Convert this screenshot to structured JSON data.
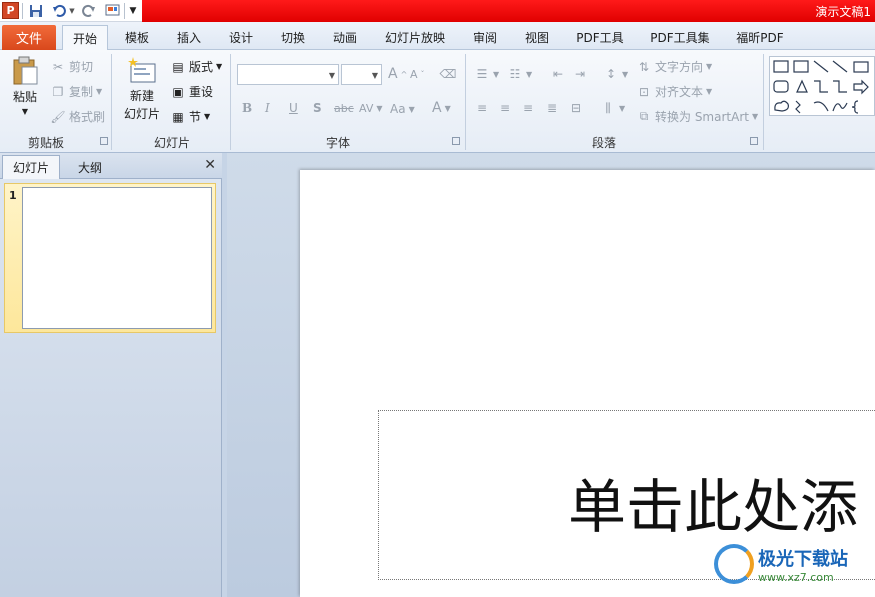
{
  "window": {
    "title": "演示文稿1"
  },
  "app": {
    "icon_letter": "P"
  },
  "tabs": {
    "file": "文件",
    "items": [
      "开始",
      "模板",
      "插入",
      "设计",
      "切换",
      "动画",
      "幻灯片放映",
      "审阅",
      "视图",
      "PDF工具",
      "PDF工具集",
      "福昕PDF"
    ],
    "active": "开始"
  },
  "ribbon": {
    "clipboard": {
      "label": "剪贴板",
      "paste": "粘贴",
      "cut": "剪切",
      "copy": "复制",
      "format_painter": "格式刷"
    },
    "slides": {
      "label": "幻灯片",
      "new_slide_line1": "新建",
      "new_slide_line2": "幻灯片",
      "layout": "版式",
      "reset": "重设",
      "section": "节"
    },
    "font": {
      "label": "字体",
      "font_name": "",
      "font_size": "",
      "bold": "B",
      "italic": "I",
      "underline": "U",
      "shadow": "S",
      "strike": "abc",
      "spacing": "AV",
      "case": "Aa",
      "color": "A",
      "grow": "A",
      "shrink": "A"
    },
    "paragraph": {
      "label": "段落",
      "text_direction": "文字方向",
      "align_text": "对齐文本",
      "smartart": "转换为 SmartArt"
    }
  },
  "left_pane": {
    "tabs": [
      "幻灯片",
      "大纲"
    ],
    "active_tab": "幻灯片",
    "slide_number": "1"
  },
  "slide": {
    "title_placeholder": "单击此处添"
  },
  "watermark": {
    "main": "极光下载站",
    "sub": "www.xz7.com"
  }
}
